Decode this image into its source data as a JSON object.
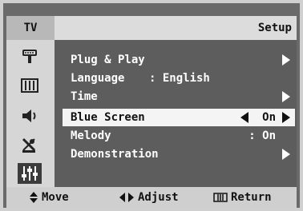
{
  "header": {
    "tv_label": "TV",
    "title": "Setup"
  },
  "sidebar": {
    "icons": [
      {
        "name": "input-icon"
      },
      {
        "name": "picture-icon"
      },
      {
        "name": "sound-icon"
      },
      {
        "name": "channel-icon"
      },
      {
        "name": "setup-icon",
        "active": true
      }
    ]
  },
  "menu": {
    "items": [
      {
        "label": "Plug & Play",
        "has_submenu": true
      },
      {
        "label": "Language",
        "value": ": English"
      },
      {
        "label": "Time",
        "has_submenu": true
      },
      {
        "label": "Blue Screen",
        "value": "On",
        "selected": true
      },
      {
        "label": "Melody",
        "value": ": On"
      },
      {
        "label": "Demonstration",
        "has_submenu": true
      }
    ]
  },
  "footer": {
    "move": "Move",
    "adjust": "Adjust",
    "return": "Return"
  },
  "colors": {
    "background": "#6a6a6a",
    "highlight": "#f4f4f4",
    "bar": "#cfcfcf"
  }
}
